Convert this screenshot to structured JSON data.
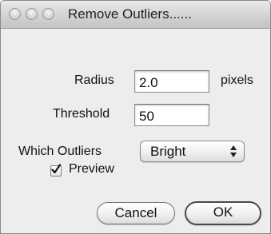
{
  "window": {
    "title": "Remove Outliers......"
  },
  "form": {
    "radius": {
      "label": "Radius",
      "value": "2.0",
      "unit": "pixels"
    },
    "threshold": {
      "label": "Threshold",
      "value": "50"
    },
    "which_outliers": {
      "label": "Which Outliers",
      "selected": "Bright"
    },
    "preview": {
      "label": "Preview",
      "checked": true
    }
  },
  "buttons": {
    "cancel": "Cancel",
    "ok": "OK"
  }
}
